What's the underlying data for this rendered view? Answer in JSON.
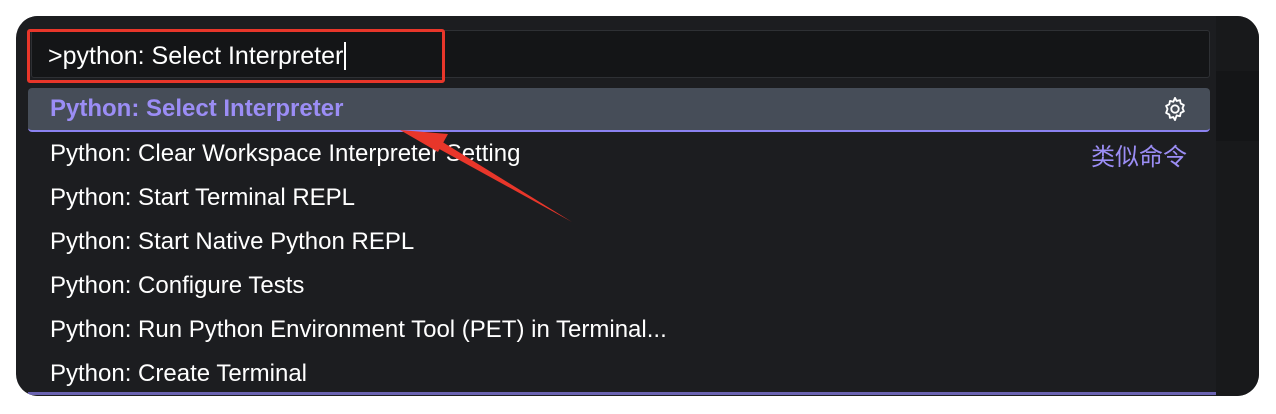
{
  "command_input": {
    "value": ">python: Select Interpreter"
  },
  "items": [
    {
      "label": "Python: Select Interpreter",
      "selected": true,
      "action_icon": "gear-icon"
    },
    {
      "label": "Python: Clear Workspace Interpreter Setting",
      "badge": "类似命令"
    },
    {
      "label": "Python: Start Terminal REPL"
    },
    {
      "label": "Python: Start Native Python REPL"
    },
    {
      "label": "Python: Configure Tests"
    },
    {
      "label": "Python: Run Python Environment Tool (PET) in Terminal..."
    },
    {
      "label": "Python: Create Terminal"
    }
  ],
  "colors": {
    "selected_text": "#9b8df5",
    "highlight_annotation": "#e8362a",
    "background": "#1c1d20"
  }
}
